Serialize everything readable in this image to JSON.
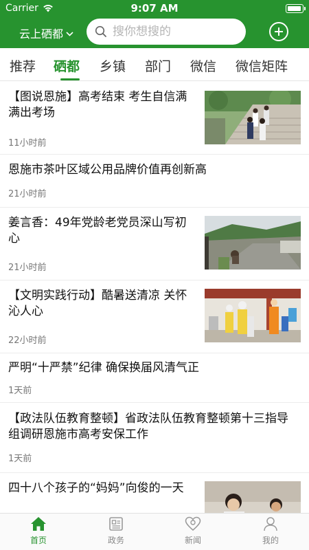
{
  "status_bar": {
    "carrier": "Carrier",
    "time": "9:07 AM"
  },
  "header": {
    "region": "云上硒都",
    "search_placeholder": "搜你想搜的"
  },
  "tabs": [
    {
      "label": "推荐"
    },
    {
      "label": "硒都"
    },
    {
      "label": "乡镇"
    },
    {
      "label": "部门"
    },
    {
      "label": "微信"
    },
    {
      "label": "微信矩阵"
    }
  ],
  "active_tab": "硒都",
  "news": [
    {
      "title": "【图说恩施】高考结束 考生自信满满出考场",
      "time": "11小时前",
      "thumbnail": "students-stairs"
    },
    {
      "title": "恩施市茶叶区域公用品牌价值再创新高",
      "time": "21小时前"
    },
    {
      "title": "姜言香：49年党龄老党员深山写初心",
      "time": "21小时前",
      "thumbnail": "mountain-road"
    },
    {
      "title": "【文明实践行动】酷暑送清凉 关怀沁人心",
      "time": "22小时前",
      "thumbnail": "volunteers-vests"
    },
    {
      "title": "严明“十严禁”纪律 确保换届风清气正",
      "time": "1天前"
    },
    {
      "title": "【政法队伍教育整顿】省政法队伍教育整顿第十三指导组调研恩施市高考安保工作",
      "time": "1天前"
    },
    {
      "title": "四十八个孩子的“妈妈”向俊的一天",
      "thumbnail": "woman-child"
    }
  ],
  "bottom_nav": [
    {
      "label": "首页",
      "icon": "home-icon"
    },
    {
      "label": "政务",
      "icon": "newspaper-icon"
    },
    {
      "label": "新闻",
      "icon": "heart-location-icon"
    },
    {
      "label": "我的",
      "icon": "user-icon"
    }
  ],
  "colors": {
    "brand": "#27932f",
    "text": "#111111",
    "muted": "#777777"
  }
}
